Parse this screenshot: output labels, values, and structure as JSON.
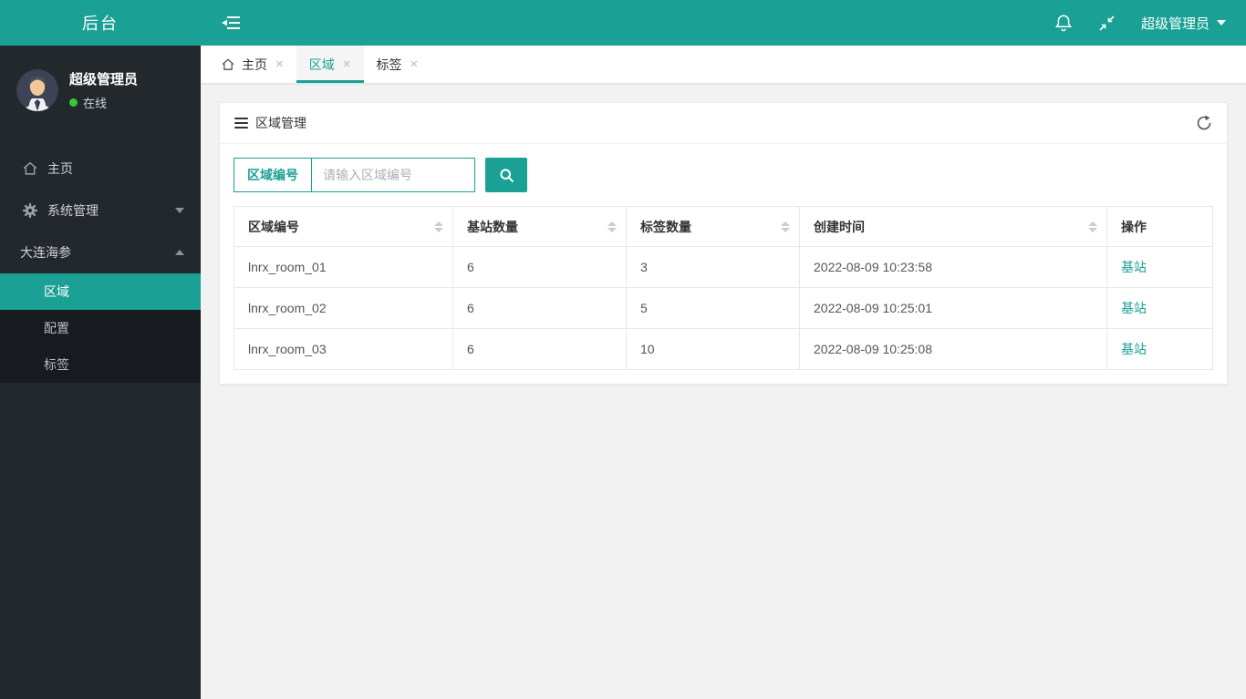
{
  "colors": {
    "teal": "#1aa094",
    "online_green": "#35c936",
    "link_teal": "#1aa094"
  },
  "icons": {
    "close": "×"
  },
  "sidebar": {
    "logo": "后台",
    "user": {
      "name": "超级管理员",
      "status": "在线"
    },
    "menu": [
      {
        "label": "主页",
        "icon": "home"
      },
      {
        "label": "系统管理",
        "icon": "gear",
        "caret": "down"
      },
      {
        "label": "大连海参",
        "caret": "up"
      }
    ],
    "submenu": [
      {
        "label": "区域",
        "active": true
      },
      {
        "label": "配置"
      },
      {
        "label": "标签"
      }
    ]
  },
  "topbar": {
    "user_menu": "超级管理员"
  },
  "tabs": [
    {
      "label": "主页",
      "icon": "home"
    },
    {
      "label": "区域",
      "active": true
    },
    {
      "label": "标签"
    }
  ],
  "panel": {
    "title": "区域管理"
  },
  "search": {
    "field_label": "区域编号",
    "placeholder": "请输入区域编号"
  },
  "table": {
    "columns": [
      {
        "label": "区域编号",
        "sortable": true
      },
      {
        "label": "基站数量",
        "sortable": true
      },
      {
        "label": "标签数量",
        "sortable": true
      },
      {
        "label": "创建时间",
        "sortable": true
      },
      {
        "label": "操作",
        "sortable": false
      }
    ],
    "rows": [
      {
        "area_id": "lnrx_room_01",
        "station_count": "6",
        "tag_count": "3",
        "created_at": "2022-08-09 10:23:58",
        "action": "基站"
      },
      {
        "area_id": "lnrx_room_02",
        "station_count": "6",
        "tag_count": "5",
        "created_at": "2022-08-09 10:25:01",
        "action": "基站"
      },
      {
        "area_id": "lnrx_room_03",
        "station_count": "6",
        "tag_count": "10",
        "created_at": "2022-08-09 10:25:08",
        "action": "基站"
      }
    ]
  }
}
